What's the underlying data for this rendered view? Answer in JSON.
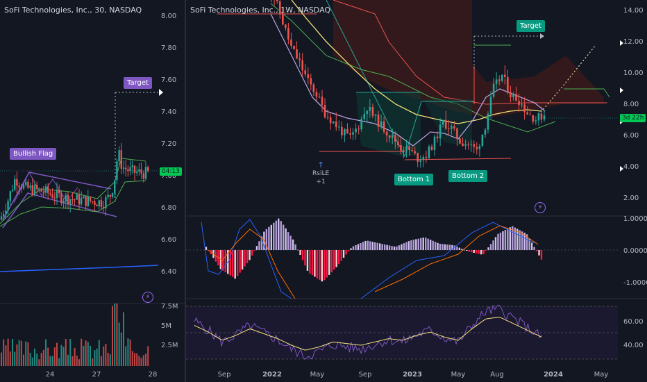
{
  "left_panel": {
    "title": "SoFi Technologies, Inc., 30, NASDAQ",
    "price_ticks": [
      "8.00",
      "7.80",
      "7.60",
      "7.40",
      "7.20",
      "7.00",
      "6.80",
      "6.60",
      "6.40"
    ],
    "price_range": [
      6.32,
      8.06
    ],
    "volume_ticks": [
      "7.5M",
      "5M",
      "2.5M"
    ],
    "date_ticks": [
      "24",
      "27",
      "28"
    ],
    "labels": {
      "flag": "Bullish Flag",
      "target": "Target"
    },
    "time_tag": "04:13",
    "lightning_icon": "lightning-icon"
  },
  "right_panel": {
    "title": "SoFi Technologies, Inc., 1W, NASDAQ",
    "price_ticks": [
      "14.00",
      "12.00",
      "10.00",
      "8.00",
      "6.00",
      "4.00",
      "2.00"
    ],
    "price_range": [
      1.2,
      14.4
    ],
    "macd_ticks": [
      "1.0000",
      "0.0000",
      "-1.0000"
    ],
    "rsi_ticks": [
      "60.00",
      "40.00"
    ],
    "date_ticks": [
      {
        "label": "Sep",
        "bold": false
      },
      {
        "label": "2022",
        "bold": true
      },
      {
        "label": "May",
        "bold": false
      },
      {
        "label": "Sep",
        "bold": false
      },
      {
        "label": "2023",
        "bold": true
      },
      {
        "label": "May",
        "bold": false
      },
      {
        "label": "Aug",
        "bold": false
      },
      {
        "label": "2024",
        "bold": true
      },
      {
        "label": "May",
        "bold": false
      }
    ],
    "labels": {
      "target": "Target",
      "bottom1": "Bottom 1",
      "bottom2": "Bottom 2",
      "rsi_line1": "RsiLE",
      "rsi_line2": "+1"
    },
    "countdown_tag": "3d 22h",
    "lightning_icon": "lightning-icon"
  },
  "colors": {
    "background": "#131722",
    "bull": "#26a69a",
    "bear": "#ef5350",
    "green": "#4caf50",
    "purple": "#7e57c2",
    "yellow": "#f5e27a",
    "macd_purple": "#b39ddb",
    "macd_red": "#ff1744",
    "signal_orange": "#ff6d00",
    "macd_blue": "#2962ff"
  },
  "chart_data": [
    {
      "type": "candlestick",
      "title": "SoFi Technologies, Inc., 30, NASDAQ",
      "x": [
        "24",
        "27",
        "28"
      ],
      "ylim": [
        6.32,
        8.06
      ],
      "annotations": [
        "Bullish Flag",
        "Target"
      ],
      "ohlc_approx": [
        [
          6.72,
          6.78,
          6.68,
          6.74
        ],
        [
          6.74,
          6.86,
          6.72,
          6.84
        ],
        [
          6.84,
          6.95,
          6.8,
          6.92
        ],
        [
          6.92,
          7.02,
          6.88,
          6.98
        ],
        [
          6.98,
          7.02,
          6.9,
          6.94
        ],
        [
          6.94,
          6.98,
          6.86,
          6.9
        ],
        [
          6.9,
          6.96,
          6.84,
          6.92
        ],
        [
          6.92,
          6.96,
          6.84,
          6.88
        ],
        [
          6.88,
          6.94,
          6.82,
          6.9
        ],
        [
          6.9,
          6.94,
          6.82,
          6.86
        ],
        [
          6.86,
          6.9,
          6.8,
          6.84
        ],
        [
          6.84,
          6.9,
          6.8,
          6.86
        ],
        [
          6.86,
          6.9,
          6.82,
          6.85
        ],
        [
          6.85,
          6.88,
          6.81,
          6.83
        ],
        [
          6.83,
          6.88,
          6.8,
          6.86
        ],
        [
          6.86,
          6.9,
          6.82,
          6.84
        ],
        [
          6.84,
          6.86,
          6.78,
          6.8
        ],
        [
          6.8,
          6.84,
          6.77,
          6.82
        ],
        [
          6.82,
          6.86,
          6.79,
          6.84
        ],
        [
          6.84,
          6.9,
          6.82,
          6.88
        ],
        [
          6.88,
          6.98,
          6.86,
          6.96
        ],
        [
          6.96,
          7.2,
          6.94,
          7.14
        ],
        [
          7.14,
          7.2,
          7.0,
          7.06
        ],
        [
          7.06,
          7.1,
          6.98,
          7.02
        ],
        [
          7.02,
          7.06,
          6.98,
          7.04
        ],
        [
          7.04,
          7.06,
          6.99,
          7.01
        ],
        [
          7.01,
          7.04,
          6.98,
          7.02
        ]
      ],
      "volume_range": [
        0,
        7500000
      ],
      "volume_ticks": [
        "7.5M",
        "5M",
        "2.5M"
      ]
    },
    {
      "type": "candlestick",
      "title": "SoFi Technologies, Inc., 1W, NASDAQ",
      "x": [
        "Sep",
        "2022",
        "May",
        "Sep",
        "2023",
        "May",
        "Aug",
        "2024",
        "May"
      ],
      "ylim": [
        1.2,
        14.4
      ],
      "annotations": [
        "Target",
        "Bottom 1",
        "Bottom 2",
        "RsiLE +1"
      ],
      "close_approx": [
        [
          0,
          15.6
        ],
        [
          1,
          14.8
        ],
        [
          2,
          13.2
        ],
        [
          3,
          11.6
        ],
        [
          4,
          10.6
        ],
        [
          5,
          9.4
        ],
        [
          6,
          8.6
        ],
        [
          7,
          7.4
        ],
        [
          8,
          6.8
        ],
        [
          9,
          6.2
        ],
        [
          10,
          5.8
        ],
        [
          11,
          6.6
        ],
        [
          12,
          7.8
        ],
        [
          13,
          7.0
        ],
        [
          14,
          6.4
        ],
        [
          15,
          5.8
        ],
        [
          16,
          5.2
        ],
        [
          17,
          5.0
        ],
        [
          18,
          4.5
        ],
        [
          19,
          4.7
        ],
        [
          20,
          5.6
        ],
        [
          21,
          6.8
        ],
        [
          22,
          6.4
        ],
        [
          23,
          5.6
        ],
        [
          24,
          5.4
        ],
        [
          25,
          5.0
        ],
        [
          26,
          6.6
        ],
        [
          27,
          9.0
        ],
        [
          28,
          9.8
        ],
        [
          29,
          8.6
        ],
        [
          30,
          8.2
        ],
        [
          31,
          7.4
        ],
        [
          32,
          7.0
        ],
        [
          33,
          7.3
        ]
      ],
      "macd_range": [
        -1.5,
        1.0
      ],
      "macd_ticks": [
        "1.0000",
        "0.0000",
        "-1.0000"
      ],
      "macd_histogram": [
        0.1,
        -0.6,
        -0.9,
        -0.3,
        0.6,
        1.0,
        0.3,
        -0.7,
        -1.0,
        -0.5,
        0.1,
        0.3,
        0.2,
        0.1,
        0.3,
        0.4,
        0.2,
        0.15,
        -0.05,
        -0.15,
        0.5,
        0.75,
        0.5,
        -0.3
      ],
      "rsi_range": [
        27,
        73
      ],
      "rsi_ticks": [
        "60.00",
        "40.00"
      ],
      "rsi_values": [
        60,
        52,
        42,
        48,
        56,
        50,
        44,
        36,
        30,
        34,
        40,
        38,
        36,
        40,
        44,
        42,
        48,
        52,
        46,
        42,
        56,
        68,
        70,
        62,
        54,
        46
      ]
    }
  ]
}
